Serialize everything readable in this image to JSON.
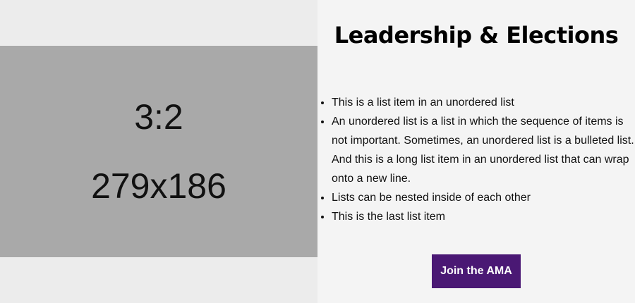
{
  "placeholder_image": {
    "ratio_label": "3:2",
    "size_label": "279x186"
  },
  "section": {
    "title": "Leadership & Elections",
    "list_items": [
      "This is a list item in an unordered list",
      "An unordered list is a list in which the sequence of items is not important. Sometimes, an unordered list is a bulleted list. And this is a long list item in an unordered list that can wrap onto a new line.",
      "Lists can be nested inside of each other",
      "This is the last list item"
    ],
    "cta_label": "Join the AMA"
  },
  "colors": {
    "cta_background": "#4a1874",
    "placeholder_background": "#a9a9a9",
    "page_background": "#f4f4f4"
  }
}
